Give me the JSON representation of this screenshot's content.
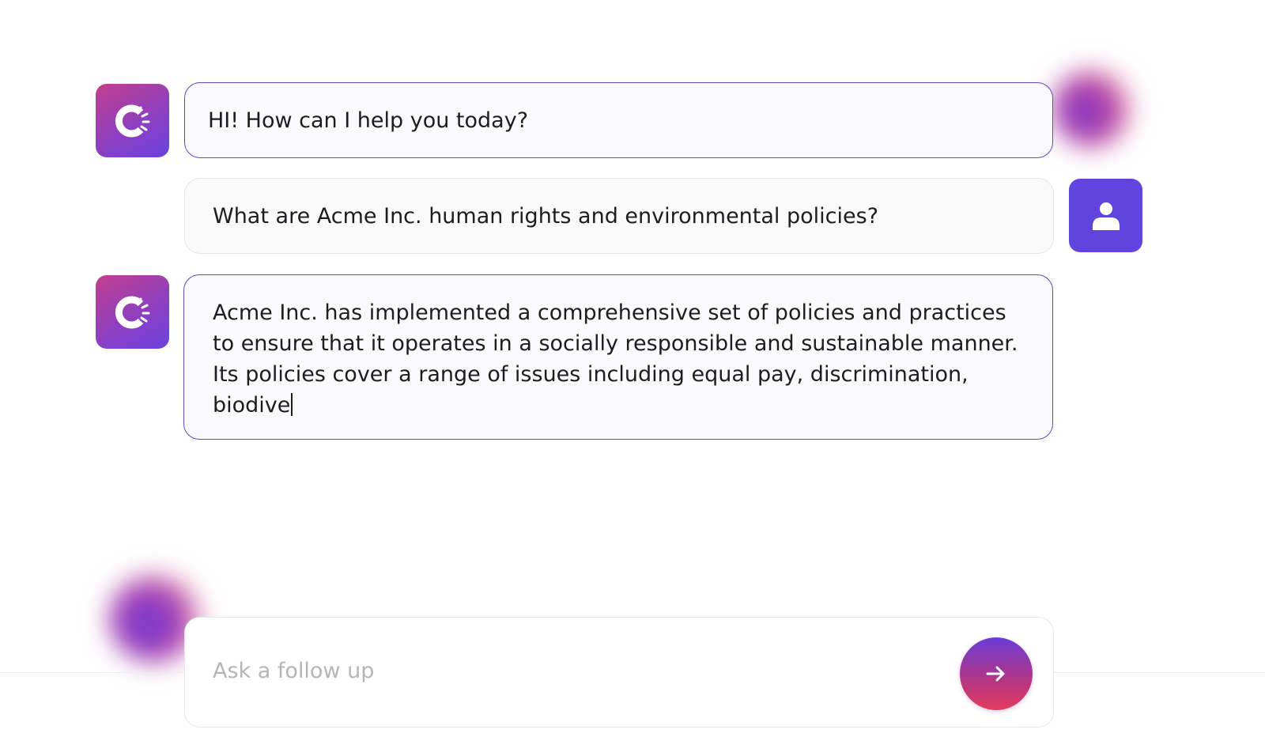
{
  "conversation": {
    "messages": [
      {
        "role": "assistant",
        "text": "HI! How can I help you today?"
      },
      {
        "role": "user",
        "text": "What are Acme Inc. human rights and environmental policies?"
      },
      {
        "role": "assistant",
        "text": "Acme Inc. has implemented a comprehensive set of policies and practices to ensure that it operates in a socially responsible and sustainable manner. Its policies cover a range of issues including equal pay, discrimination, biodive",
        "streaming": true
      }
    ]
  },
  "composer": {
    "placeholder": "Ask a follow up",
    "send_icon": "arrow-right-icon"
  },
  "icons": {
    "assistant_avatar": "brand-logo-icon",
    "user_avatar": "user-icon"
  },
  "colors": {
    "accent": "#5f45dd",
    "brand_pink": "#c23f8e",
    "send_gradient_top": "#6a3cd8",
    "send_gradient_bottom": "#e23c5f"
  }
}
